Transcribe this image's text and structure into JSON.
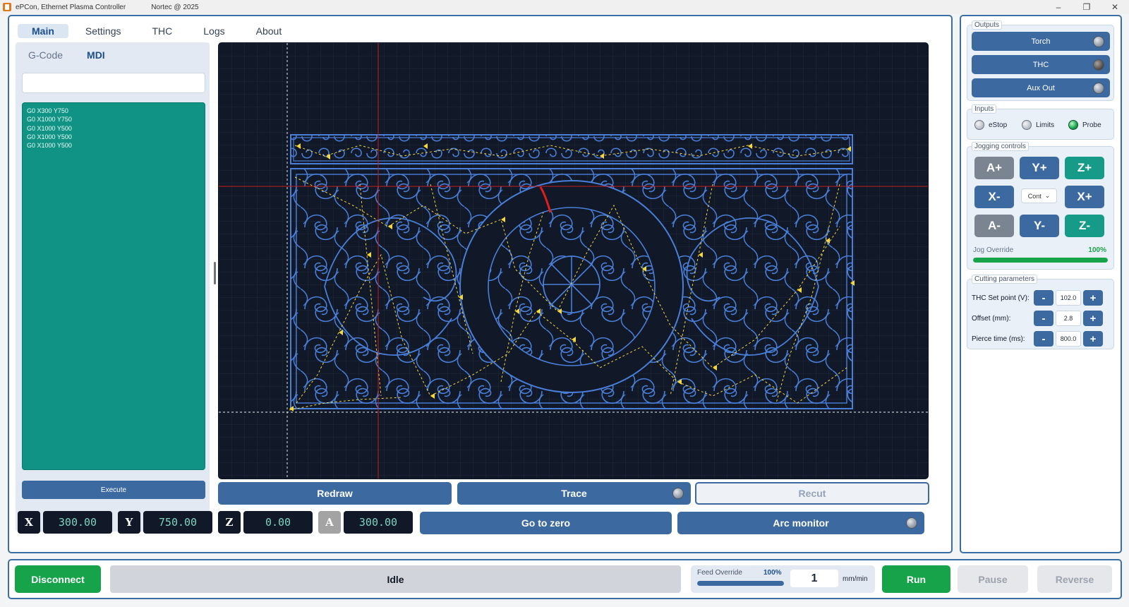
{
  "window": {
    "title": "ePCon, Ethernet Plasma Controller",
    "vendor": "Nortec @ 2025"
  },
  "tabs": [
    "Main",
    "Settings",
    "THC",
    "Logs",
    "About"
  ],
  "left": {
    "subtabs": [
      "G-Code",
      "MDI"
    ],
    "mdi_input_value": "",
    "gcode_lines": [
      "G0 X300 Y750",
      "G0 X1000 Y750",
      "G0 X1000 Y500",
      "G0 X1000 Y500",
      "G0 X1000 Y500"
    ],
    "execute_label": "Execute"
  },
  "canvas_buttons": {
    "redraw": "Redraw",
    "trace": "Trace",
    "recut": "Recut"
  },
  "coords": {
    "x_label": "X",
    "x": "300.00",
    "y_label": "Y",
    "y": "750.00",
    "z_label": "Z",
    "z": "0.00",
    "a_label": "A",
    "a": "300.00"
  },
  "controls": {
    "go_to_zero": "Go to zero",
    "arc_monitor": "Arc monitor"
  },
  "outputs": {
    "legend": "Outputs",
    "torch": "Torch",
    "thc": "THC",
    "aux_out": "Aux Out"
  },
  "inputs": {
    "legend": "Inputs",
    "estop": "eStop",
    "limits": "Limits",
    "probe": "Probe"
  },
  "jogging": {
    "legend": "Jogging controls",
    "a_plus": "A+",
    "y_plus": "Y+",
    "z_plus": "Z+",
    "x_minus": "X-",
    "mode": "Cont",
    "x_plus": "X+",
    "a_minus": "A-",
    "y_minus": "Y-",
    "z_minus": "Z-",
    "override_label": "Jog Override",
    "override_value": "100%",
    "override_level": 1.0
  },
  "cutting": {
    "legend": "Cutting parameters",
    "thc_setpoint_label": "THC Set point (V):",
    "thc_setpoint": "102.0",
    "offset_label": "Offset (mm):",
    "offset": "2.8",
    "pierce_label": "Pierce time (ms):",
    "pierce": "800.0",
    "minus": "-",
    "plus": "+"
  },
  "bottom": {
    "disconnect": "Disconnect",
    "status": "Idle",
    "feed_label": "Feed Override",
    "feed_pct": "100%",
    "feed_level": 1.0,
    "feed_value": "1",
    "feed_unit": "mm/min",
    "run": "Run",
    "pause": "Pause",
    "reverse": "Reverse"
  },
  "colors": {
    "accent_blue": "#3c6aa0",
    "gcode_bg": "#109385",
    "canvas_bg": "#111827",
    "part_outline": "#4a7fd9",
    "rapid_path": "#f5d742",
    "active_cut": "#e11d1d",
    "green": "#16a34a"
  }
}
